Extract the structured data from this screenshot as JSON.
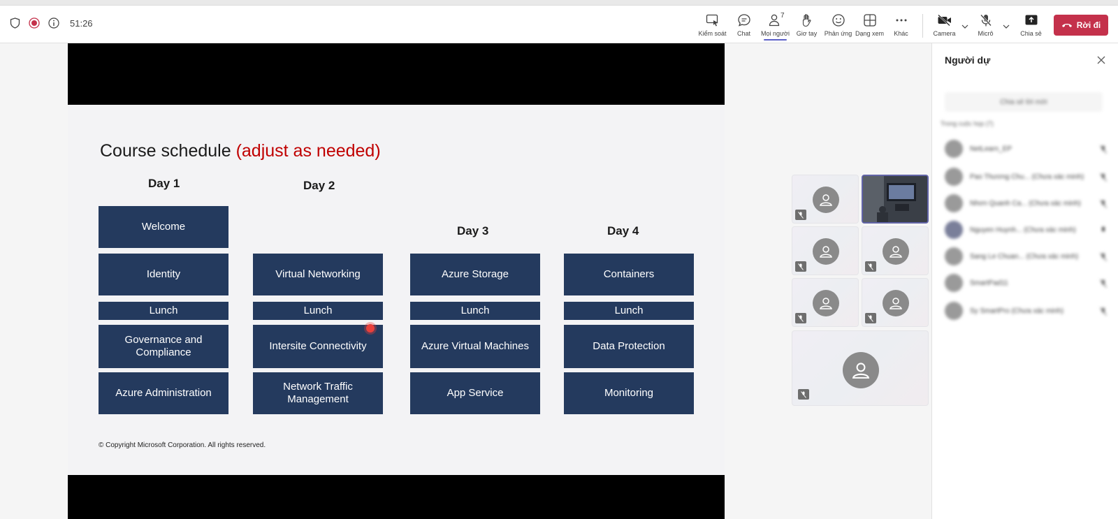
{
  "meeting": {
    "timer": "51:26"
  },
  "toolbar": {
    "control": "Kiểm soát",
    "chat": "Chat",
    "people": "Mọi người",
    "people_count": "7",
    "raise_hand": "Giơ tay",
    "react": "Phản ứng",
    "view": "Dạng xem",
    "more": "Khác",
    "camera": "Camera",
    "mic": "Micrô",
    "share": "Chia sẻ",
    "leave": "Rời đi"
  },
  "slide": {
    "title": "Course schedule",
    "title_note": "(adjust as needed)",
    "days": [
      "Day 1",
      "Day 2",
      "Day 3",
      "Day 4"
    ],
    "day1": [
      "Welcome",
      "Identity",
      "Lunch",
      "Governance and Compliance",
      "Azure Administration"
    ],
    "day2": [
      "Virtual Networking",
      "Lunch",
      "Intersite Connectivity",
      "Network Traffic Management"
    ],
    "day3": [
      "Azure Storage",
      "Lunch",
      "Azure Virtual Machines",
      "App Service"
    ],
    "day4": [
      "Containers",
      "Lunch",
      "Data Protection",
      "Monitoring"
    ],
    "copyright": "© Copyright Microsoft Corporation. All rights reserved.",
    "box_color": "#243a5e",
    "accent_red": "#c00000"
  },
  "panel": {
    "title": "Người dự",
    "invite": "Chia sẻ lời mời",
    "section": "Trong cuộc họp (7)",
    "people": [
      "NetLearn_EP",
      "Pao Thương Chu... (Chưa xác minh)",
      "Nhơn Quanh Ca... (Chưa xác minh)",
      "Nguyen Huynh... (Chưa xác minh)",
      "Sang Le Chuan... (Chưa xác minh)",
      "SmartPad11",
      "Sy SmartPro (Chưa xác minh)"
    ]
  },
  "colors": {
    "leave_button": "#c4314b",
    "active_tab": "#5b5fc7"
  }
}
